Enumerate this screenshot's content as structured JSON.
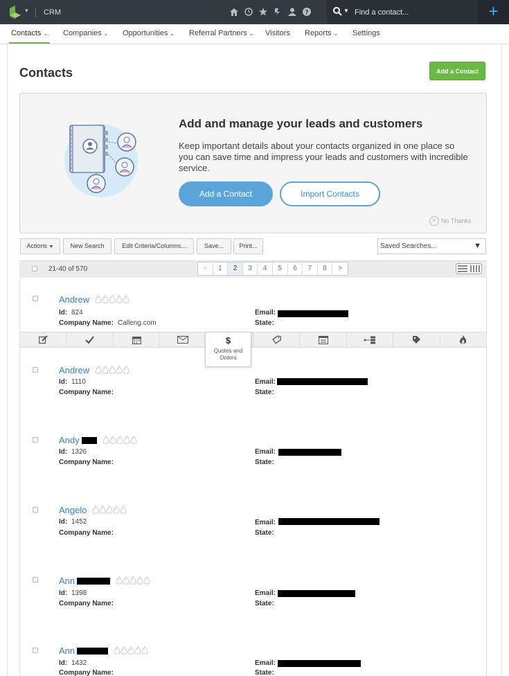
{
  "topbar": {
    "app_title": "CRM",
    "search_placeholder": "Find a contact...",
    "icons": [
      "home-icon",
      "clock-icon",
      "star-icon",
      "puzzle-icon",
      "user-icon",
      "help-icon"
    ],
    "plus_label": "+"
  },
  "nav": {
    "items": [
      {
        "label": "Contacts",
        "has_caret": true,
        "active": true
      },
      {
        "label": "Companies",
        "has_caret": true
      },
      {
        "label": "Opportunities",
        "has_caret": true
      },
      {
        "label": "Referral Partners",
        "has_caret": true
      },
      {
        "label": "Visitors",
        "has_caret": false
      },
      {
        "label": "Reports",
        "has_caret": true
      },
      {
        "label": "Settings",
        "has_caret": false
      }
    ]
  },
  "page": {
    "title": "Contacts",
    "add_contact_label": "Add a Contact"
  },
  "promo": {
    "title": "Add and manage your leads and customers",
    "text": "Keep important details about your contacts organized in one place so you can save time and impress your leads and customers with incredible service.",
    "add_label": "Add a Contact",
    "import_label": "Import Contacts",
    "no_thanks": "No Thanks"
  },
  "toolbar": {
    "actions": "Actions",
    "new_search": "New Search",
    "edit_criteria": "Edit Criteria/Columns...",
    "save": "Save...",
    "print": "Print...",
    "saved_searches": "Saved Searches..."
  },
  "pager": {
    "range": "21-40 of 570",
    "prev": "<",
    "next": ">",
    "pages": [
      "1",
      "2",
      "3",
      "4",
      "5",
      "6",
      "7",
      "8"
    ],
    "current": "2"
  },
  "labels": {
    "id": "Id:",
    "company": "Company Name:",
    "email": "Email:",
    "state": "State:"
  },
  "contacts": [
    {
      "name": "Andrew",
      "id": "824",
      "company": "Calleng.com"
    },
    {
      "name": "Andrew",
      "id": "1110",
      "company": ""
    },
    {
      "name": "Andy",
      "id": "1326",
      "company": ""
    },
    {
      "name": "Angelo",
      "id": "1452",
      "company": ""
    },
    {
      "name": "Ann",
      "id": "1398",
      "company": ""
    },
    {
      "name": "Ann",
      "id": "1432",
      "company": ""
    }
  ],
  "action_icons": [
    "edit-icon",
    "check-icon",
    "calendar-icon",
    "mail-icon",
    "dollar-icon",
    "tag-icon",
    "form-icon",
    "sequence-icon",
    "price-tag-icon",
    "flame-icon"
  ],
  "tooltip": {
    "symbol": "$",
    "text_line1": "Quotes and",
    "text_line2": "Orders"
  },
  "colors": {
    "topbar": "#34393f",
    "accent_green": "#6ab945",
    "link_blue": "#3a7fc0",
    "button_blue": "#5aa4d9"
  }
}
